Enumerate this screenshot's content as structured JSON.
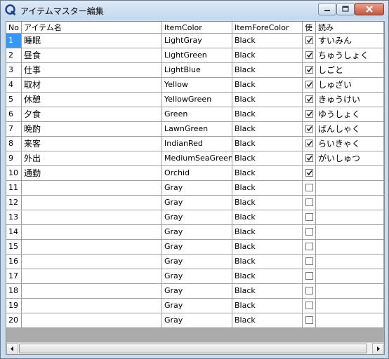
{
  "window": {
    "title": "アイテムマスター編集",
    "app_icon": "q-logo-icon",
    "controls": [
      "minimize-icon",
      "maximize-icon",
      "close-icon"
    ]
  },
  "grid": {
    "columns": [
      "No",
      "アイテム名",
      "ItemColor",
      "ItemForeColor",
      "使",
      "読み"
    ],
    "selected_row": 0,
    "rows": [
      {
        "no": "1",
        "name": "睡眠",
        "color": "LightGray",
        "fore": "Black",
        "use": true,
        "yomi": "すいみん"
      },
      {
        "no": "2",
        "name": "昼食",
        "color": "LightGreen",
        "fore": "Black",
        "use": true,
        "yomi": "ちゅうしょく"
      },
      {
        "no": "3",
        "name": "仕事",
        "color": "LightBlue",
        "fore": "Black",
        "use": true,
        "yomi": "しごと"
      },
      {
        "no": "4",
        "name": "取材",
        "color": "Yellow",
        "fore": "Black",
        "use": true,
        "yomi": "しゅざい"
      },
      {
        "no": "5",
        "name": "休憩",
        "color": "YellowGreen",
        "fore": "Black",
        "use": true,
        "yomi": "きゅうけい"
      },
      {
        "no": "6",
        "name": "夕食",
        "color": "Green",
        "fore": "Black",
        "use": true,
        "yomi": "ゆうしょく"
      },
      {
        "no": "7",
        "name": "晩酌",
        "color": "LawnGreen",
        "fore": "Black",
        "use": true,
        "yomi": "ばんしゃく"
      },
      {
        "no": "8",
        "name": "来客",
        "color": "IndianRed",
        "fore": "Black",
        "use": true,
        "yomi": "らいきゃく"
      },
      {
        "no": "9",
        "name": "外出",
        "color": "MediumSeaGreen",
        "fore": "Black",
        "use": true,
        "yomi": "がいしゅつ"
      },
      {
        "no": "10",
        "name": "通勤",
        "color": "Orchid",
        "fore": "Black",
        "use": true,
        "yomi": ""
      },
      {
        "no": "11",
        "name": "",
        "color": "Gray",
        "fore": "Black",
        "use": false,
        "yomi": ""
      },
      {
        "no": "12",
        "name": "",
        "color": "Gray",
        "fore": "Black",
        "use": false,
        "yomi": ""
      },
      {
        "no": "13",
        "name": "",
        "color": "Gray",
        "fore": "Black",
        "use": false,
        "yomi": ""
      },
      {
        "no": "14",
        "name": "",
        "color": "Gray",
        "fore": "Black",
        "use": false,
        "yomi": ""
      },
      {
        "no": "15",
        "name": "",
        "color": "Gray",
        "fore": "Black",
        "use": false,
        "yomi": ""
      },
      {
        "no": "16",
        "name": "",
        "color": "Gray",
        "fore": "Black",
        "use": false,
        "yomi": ""
      },
      {
        "no": "17",
        "name": "",
        "color": "Gray",
        "fore": "Black",
        "use": false,
        "yomi": ""
      },
      {
        "no": "18",
        "name": "",
        "color": "Gray",
        "fore": "Black",
        "use": false,
        "yomi": ""
      },
      {
        "no": "19",
        "name": "",
        "color": "Gray",
        "fore": "Black",
        "use": false,
        "yomi": ""
      },
      {
        "no": "20",
        "name": "",
        "color": "Gray",
        "fore": "Black",
        "use": false,
        "yomi": ""
      }
    ]
  },
  "colors": {
    "selection": "#3399ff",
    "grid_line": "#a0a0a0",
    "empty_area": "#ababab"
  }
}
